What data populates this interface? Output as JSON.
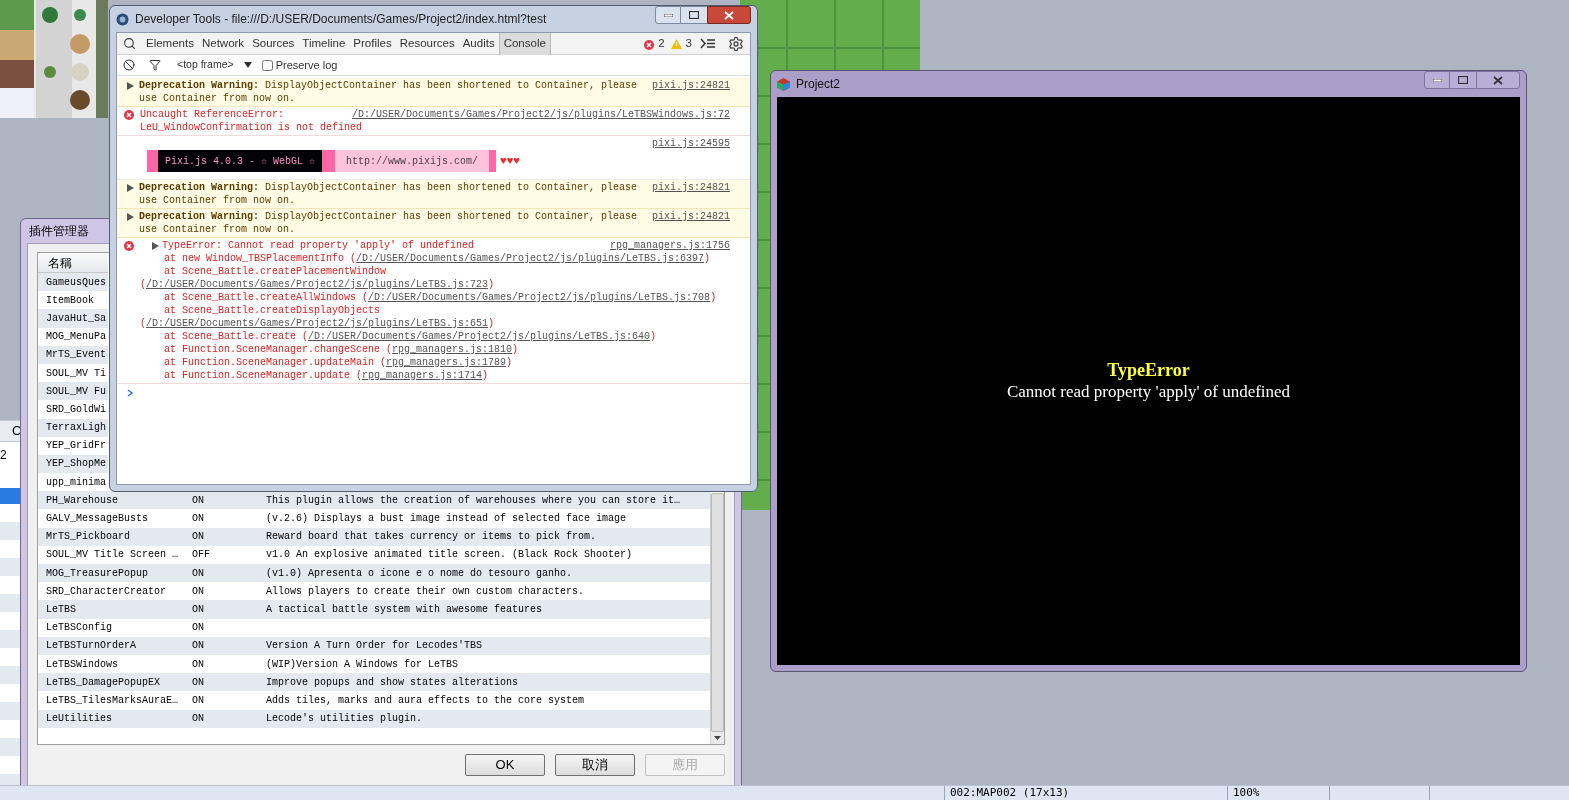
{
  "left_panel": {
    "header": "C",
    "cell": "2"
  },
  "plugin_manager": {
    "title": "插件管理器",
    "column": "名稱",
    "rows": [
      {
        "name": "GameusQues"
      },
      {
        "name": "ItemBook"
      },
      {
        "name": "JavaHut_Sa"
      },
      {
        "name": "MOG_MenuPa"
      },
      {
        "name": "MrTS_Event"
      },
      {
        "name": "SOUL_MV Ti"
      },
      {
        "name": "SOUL_MV Fu"
      },
      {
        "name": "SRD_GoldWi"
      },
      {
        "name": "TerraxLigh"
      },
      {
        "name": "YEP_GridFr"
      },
      {
        "name": "YEP_ShopMe"
      },
      {
        "name": "upp_minima"
      },
      {
        "name": "PH_Warehouse",
        "status": "ON",
        "description": "This plugin allows the creation of warehouses where you can store it…"
      },
      {
        "name": "GALV_MessageBusts",
        "status": "ON",
        "description": "(v.2.6) Displays a bust image instead of selected face image"
      },
      {
        "name": "MrTS_Pickboard",
        "status": "ON",
        "description": "Reward board that takes currency or items to pick from."
      },
      {
        "name": "SOUL_MV Title Screen …",
        "status": "OFF",
        "description": "v1.0 An explosive animated title screen. (Black Rock Shooter)"
      },
      {
        "name": "MOG_TreasurePopup",
        "status": "ON",
        "description": "(v1.0) Apresenta o ícone e o nome do tesouro ganho."
      },
      {
        "name": "SRD_CharacterCreator",
        "status": "ON",
        "description": "Allows players to create their own custom characters."
      },
      {
        "name": "LeTBS",
        "status": "ON",
        "description": "A tactical battle system with awesome features"
      },
      {
        "name": "LeTBSConfig",
        "status": "ON"
      },
      {
        "name": "LeTBSTurnOrderA",
        "status": "ON",
        "description": "Version A Turn Order for Lecodes'TBS"
      },
      {
        "name": "LeTBSWindows",
        "status": "ON",
        "description": "(WIP)Version A Windows for LeTBS"
      },
      {
        "name": "LeTBS_DamagePopupEX",
        "status": "ON",
        "description": "Improve popups and show states alterations"
      },
      {
        "name": "LeTBS_TilesMarksAuraE…",
        "status": "ON",
        "description": "Adds tiles, marks and aura effects to the core system"
      },
      {
        "name": "LeUtilities",
        "status": "ON",
        "description": "Lecode's utilities plugin."
      }
    ],
    "buttons": [
      {
        "label": "OK",
        "disabled": false
      },
      {
        "label": "取消",
        "disabled": false
      },
      {
        "label": "應用",
        "disabled": true
      }
    ]
  },
  "devtools": {
    "title": "Developer Tools - file:///D:/USER/Documents/Games/Project2/index.html?test",
    "tabs": [
      {
        "label": "Elements",
        "selected": false
      },
      {
        "label": "Network",
        "selected": false
      },
      {
        "label": "Sources",
        "selected": false
      },
      {
        "label": "Timeline",
        "selected": false
      },
      {
        "label": "Profiles",
        "selected": false
      },
      {
        "label": "Resources",
        "selected": false
      },
      {
        "label": "Audits",
        "selected": false
      },
      {
        "label": "Console",
        "selected": true
      }
    ],
    "errors": "2",
    "warnings": "3",
    "context": "<top frame>",
    "preserve_log": {
      "label": "Preserve log",
      "checked": false
    },
    "messages": [
      {
        "kind": "warning",
        "text": "**Deprecation Warning:** DisplayObjectContainer has been shortened to Container, please use Container from now on.",
        "source": "pixi.js:24821"
      },
      {
        "kind": "error",
        "lines": [
          "Uncaught ReferenceError:",
          "LeU_WindowConfirmation is not defined"
        ],
        "source": "/D:/USER/Documents/Games/Project2/js/plugins/LeTBSWindows.js:72"
      },
      {
        "kind": "banner",
        "segments": [
          "Pixi.js 4.0.3 - ☆ WebGL ☆",
          "http://www.pixijs.com/",
          "♥♥♥"
        ],
        "source": "pixi.js:24595"
      },
      {
        "kind": "warning",
        "text": "**Deprecation Warning:** DisplayObjectContainer has been shortened to Container, please use Container from now on.",
        "source": "pixi.js:24821"
      },
      {
        "kind": "warning",
        "text": "**Deprecation Warning:** DisplayObjectContainer has been shortened to Container, please use Container from now on.",
        "source": "pixi.js:24821"
      },
      {
        "kind": "exception",
        "text": "TypeError: Cannot read property 'apply' of undefined",
        "source": "rpg_managers.js:1756",
        "frames": [
          {
            "call": "at new Window_TBSPlacementInfo ",
            "open": "(",
            "link": "/D:/USER/Documents/Games/Project2/js/plugins/LeTBS.js:6397",
            "close": ")",
            "break": false
          },
          {
            "call": "at Scene_Battle.createPlacementWindow",
            "open": "(",
            "link": "/D:/USER/Documents/Games/Project2/js/plugins/LeTBS.js:723",
            "close": ")",
            "break": true
          },
          {
            "call": "at Scene_Battle.createAllWindows ",
            "open": "(",
            "link": "/D:/USER/Documents/Games/Project2/js/plugins/LeTBS.js:708",
            "close": ")",
            "break": false
          },
          {
            "call": "at Scene_Battle.createDisplayObjects",
            "open": "(",
            "link": "/D:/USER/Documents/Games/Project2/js/plugins/LeTBS.js:651",
            "close": ")",
            "break": true
          },
          {
            "call": "at Scene_Battle.create ",
            "open": "(",
            "link": "/D:/USER/Documents/Games/Project2/js/plugins/LeTBS.js:640",
            "close": ")",
            "break": false
          },
          {
            "call": "at Function.SceneManager.changeScene ",
            "open": "(",
            "link": "rpg_managers.js:1810",
            "close": ")",
            "break": false
          },
          {
            "call": "at Function.SceneManager.updateMain ",
            "open": "(",
            "link": "rpg_managers.js:1789",
            "close": ")",
            "break": false
          },
          {
            "call": "at Function.SceneManager.update ",
            "open": "(",
            "link": "rpg_managers.js:1714",
            "close": ")",
            "break": false
          }
        ]
      }
    ]
  },
  "game_window": {
    "title": "Project2",
    "error_title": "TypeError",
    "error_message": "Cannot read property 'apply' of undefined"
  },
  "status_bar": [
    "002:MAP002 (17x13)",
    "100%"
  ]
}
